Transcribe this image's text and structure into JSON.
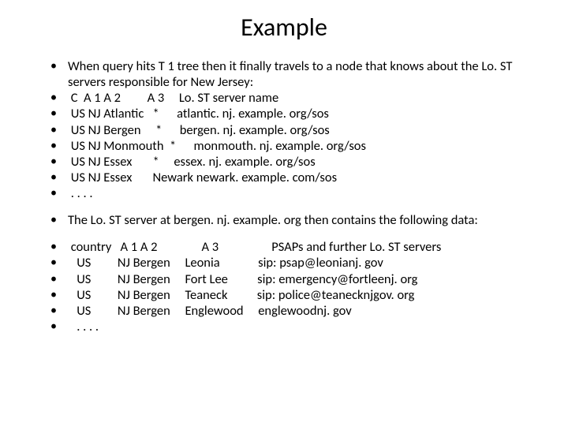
{
  "title": "Example",
  "block1": {
    "intro": "When query hits T 1 tree then it finally travels to a node that knows about the Lo. ST servers responsible for New Jersey:",
    "rows": [
      "",
      " C  A 1 A 2         A 3     Lo. ST server name",
      " US NJ Atlantic   *      atlantic. nj. example. org/sos",
      " US NJ Bergen     *      bergen. nj. example. org/sos",
      " US NJ Monmouth  *      monmouth. nj. example. org/sos",
      " US NJ Essex       *     essex. nj. example. org/sos",
      " US NJ Essex       Newark newark. example. com/sos",
      " . . . ."
    ]
  },
  "block2": {
    "intro": "The Lo. ST server at bergen. nj. example. org then contains the following data:"
  },
  "block3": {
    "rows": [
      " country   A 1 A 2               A 3                  PSAPs and further Lo. ST servers",
      "   US         NJ Bergen     Leonia             sip: psap@leonianj. gov",
      "   US         NJ Bergen     Fort Lee          sip: emergency@fortleenj. org",
      "   US         NJ Bergen     Teaneck          sip: police@teanecknjgov. org",
      "   US         NJ Bergen     Englewood     englewoodnj. gov",
      "   . . . ."
    ]
  }
}
